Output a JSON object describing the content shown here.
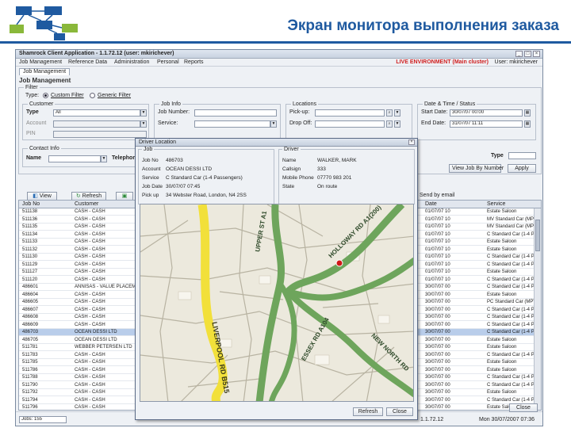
{
  "slide": {
    "title": "Экран монитора выполнения заказа",
    "brand_color": "#1f5aa0"
  },
  "app": {
    "window_title": "Shamrock Client Application - 1.1.72.12 (user: mkirichever)",
    "menu": [
      "Job Management",
      "Reference Data",
      "Administration",
      "Personal",
      "Reports"
    ],
    "live_env": "LIVE ENVIRONMENT (Main cluster)",
    "user_label": "User: mkirichever",
    "tab": "Job Management",
    "section_title": "Job Management",
    "filter": {
      "legend": "Filter",
      "type_label": "Type:",
      "custom_filter": "Custom Filter",
      "generic_filter": "Generic Filter",
      "customer": {
        "legend": "Customer",
        "type_label": "Type",
        "type_value": "All",
        "account_label": "Account",
        "pin_label": "PIN"
      },
      "job_info": {
        "legend": "Job Info",
        "job_number_label": "Job Number:",
        "service_label": "Service:"
      },
      "locations": {
        "legend": "Locations",
        "pickup_label": "Pick-up:",
        "dropoff_label": "Drop Off:"
      },
      "date_time": {
        "legend": "Date & Time / Status",
        "start_label": "Start Date:",
        "start_value": "30/07/07 00:00",
        "end_label": "End Date:",
        "end_value": "31/07/07 11:11"
      },
      "contact": {
        "legend": "Contact Info",
        "name_label": "Name",
        "telephone_label": "Telephone"
      },
      "type_right_label": "Type",
      "view_by_job_button": "View Job By Number",
      "apply_button": "Apply"
    },
    "toolbar": {
      "view": "View",
      "refresh": "Refresh",
      "send_by_email": "Send by email"
    },
    "grid": {
      "headers": [
        "Job No",
        "Customer",
        "Date",
        "Service"
      ],
      "rows": [
        [
          "511138",
          "CASH - CASH",
          "01/07/07 10",
          "Estate Saloon"
        ],
        [
          "511136",
          "CASH - CASH",
          "01/07/07 10",
          "MV Standard Car (MPV)"
        ],
        [
          "511135",
          "CASH - CASH",
          "01/07/07 10",
          "MV Standard Car (MPV)"
        ],
        [
          "511134",
          "CASH - CASH",
          "01/07/07 10",
          "C Standard Car (1-4 Passengers)"
        ],
        [
          "511133",
          "CASH - CASH",
          "01/07/07 10",
          "Estate Saloon"
        ],
        [
          "511132",
          "CASH - CASH",
          "01/07/07 10",
          "Estate Saloon"
        ],
        [
          "511130",
          "CASH - CASH",
          "01/07/07 10",
          "C Standard Car (1-4 Passengers)"
        ],
        [
          "511129",
          "CASH - CASH",
          "01/07/07 10",
          "C Standard Car (1-4 Passengers)"
        ],
        [
          "511127",
          "CASH - CASH",
          "01/07/07 10",
          "Estate Saloon"
        ],
        [
          "511120",
          "CASH - CASH",
          "01/07/07 10",
          "C Standard Car (1-4 Passengers)"
        ],
        [
          "486601",
          "ANNISAS - VALUE PLACEMENTS LTD",
          "30/07/07 00",
          "C Standard Car (1-4 Passengers)"
        ],
        [
          "486604",
          "CASH - CASH",
          "30/07/07 00",
          "Estate Saloon"
        ],
        [
          "486605",
          "CASH - CASH",
          "30/07/07 00",
          "PC Standard Car (MPV)"
        ],
        [
          "486607",
          "CASH - CASH",
          "30/07/07 00",
          "C Standard Car (1-4 Passengers)"
        ],
        [
          "486608",
          "CASH - CASH",
          "30/07/07 00",
          "C Standard Car (1-4 Passengers)"
        ],
        [
          "486609",
          "CASH - CASH",
          "30/07/07 00",
          "C Standard Car (1-4 Passengers)"
        ],
        [
          "486703",
          "OCEAN DESSI LTD",
          "30/07/07 00",
          "C Standard Car (1-4 Passengers)"
        ],
        [
          "486705",
          "OCEAN DESSI LTD",
          "30/07/07 00",
          "Estate Saloon"
        ],
        [
          "511781",
          "WEBBER PETERSEN LTD",
          "30/07/07 00",
          "Estate Saloon"
        ],
        [
          "511783",
          "CASH - CASH",
          "30/07/07 00",
          "C Standard Car (1-4 Passengers)"
        ],
        [
          "511785",
          "CASH - CASH",
          "30/07/07 00",
          "Estate Saloon"
        ],
        [
          "511786",
          "CASH - CASH",
          "30/07/07 00",
          "Estate Saloon"
        ],
        [
          "511788",
          "CASH - CASH",
          "30/07/07 00",
          "C Standard Car (1-4 Passengers)"
        ],
        [
          "511790",
          "CASH - CASH",
          "30/07/07 00",
          "C Standard Car (1-4 Passengers)"
        ],
        [
          "511792",
          "CASH - CASH",
          "30/07/07 00",
          "Estate Saloon"
        ],
        [
          "511794",
          "CASH - CASH",
          "30/07/07 00",
          "C Standard Car (1-4 Passengers)"
        ],
        [
          "511796",
          "CASH - CASH",
          "30/07/07 00",
          "Estate Saloon"
        ]
      ],
      "selected_index": 16
    },
    "bottom": {
      "status_left": "Jobs: 155",
      "version": "1.1.72.12",
      "timestamp": "Mon 30/07/2007 07:36",
      "close_button": "Close"
    }
  },
  "dialog": {
    "title": "Driver Location",
    "job": {
      "legend": "Job",
      "fields": [
        {
          "label": "Job No",
          "value": "486703"
        },
        {
          "label": "Account",
          "value": "OCEAN DESSI LTD"
        },
        {
          "label": "Service",
          "value": "C Standard Car (1-4 Passengers)"
        },
        {
          "label": "Job Date",
          "value": "30/07/07 07:45"
        },
        {
          "label": "Pick up",
          "value": "34 Webster Road, London, N4 2SS"
        }
      ]
    },
    "driver": {
      "legend": "Driver",
      "fields": [
        {
          "label": "Name",
          "value": "WALKER, MARK"
        },
        {
          "label": "Callsign",
          "value": "333"
        },
        {
          "label": "Mobile Phone",
          "value": "07770 983 201"
        },
        {
          "label": "State",
          "value": "On route"
        }
      ]
    },
    "map": {
      "road_labels": [
        "LIVERPOOL RD B515",
        "UPPER ST A1",
        "HOLLOWAY RD A1(200)",
        "ESSEX RD A104",
        "NEW NORTH RD"
      ],
      "marker_color": "#d01818"
    },
    "refresh_button": "Refresh",
    "close_button": "Close"
  }
}
